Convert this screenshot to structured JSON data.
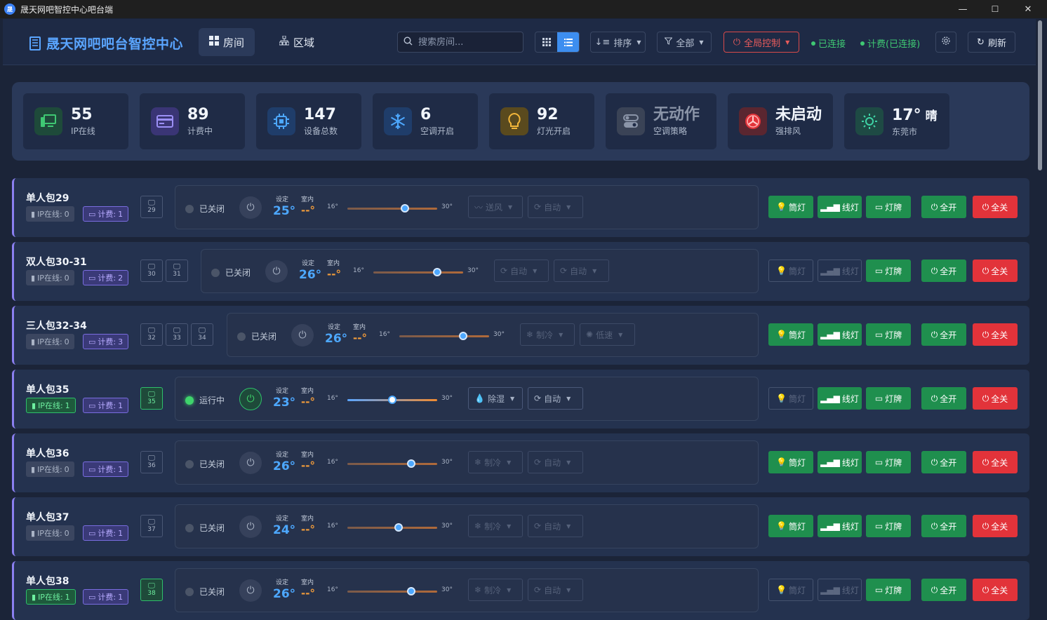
{
  "window": {
    "title": "晟天网吧智控中心吧台端",
    "app_icon": "晟",
    "min_label": "—",
    "max_label": "☐",
    "close_label": "✕"
  },
  "header": {
    "logo_text": "晟天网吧吧台智控中心",
    "nav": [
      {
        "label": "房间",
        "icon": "grid-icon"
      },
      {
        "label": "区域",
        "icon": "hierarchy-icon"
      }
    ],
    "search_placeholder": "搜索房间...",
    "sort_label": "排序",
    "filter_label": "全部",
    "global_control_label": "全局控制",
    "status_connected": "已连接",
    "status_billing": "计费(已连接)",
    "refresh_label": "刷新"
  },
  "stats": [
    {
      "value": "55",
      "label": "IP在线",
      "icon": "monitor-icon",
      "color": "#3fc873"
    },
    {
      "value": "89",
      "label": "计费中",
      "icon": "card-icon",
      "color": "#8b7ff0"
    },
    {
      "value": "147",
      "label": "设备总数",
      "icon": "chip-icon",
      "color": "#4da8ff"
    },
    {
      "value": "6",
      "label": "空调开启",
      "icon": "snowflake-icon",
      "color": "#4da8ff"
    },
    {
      "value": "92",
      "label": "灯光开启",
      "icon": "bulb-icon",
      "color": "#f4b73a"
    },
    {
      "value": "无动作",
      "label": "空调策略",
      "icon": "toggle-icon",
      "color": "#8b95a8"
    },
    {
      "value": "未启动",
      "label": "强排风",
      "icon": "fan-icon",
      "color": "#e2333a"
    },
    {
      "value": "17°",
      "value_suffix": "晴",
      "label": "东莞市",
      "icon": "sun-icon",
      "color": "#3fd4a6"
    }
  ],
  "labels": {
    "ip_online": "IP在线:",
    "billing": "计费:",
    "set": "设定",
    "indoor": "室内",
    "min": "16°",
    "max": "30°",
    "indoor_value": "--°",
    "btn_downlight": "筒灯",
    "btn_linelight": "线灯",
    "btn_sign": "灯牌",
    "btn_all_on": "全开",
    "btn_all_off": "全关"
  },
  "rooms": [
    {
      "name": "单人包29",
      "ip_online": "0",
      "billing": "1",
      "pcs": [
        "29"
      ],
      "pcs_on": [
        false
      ],
      "status": "已关闭",
      "on": false,
      "set_temp": "25°",
      "temp_value": 25,
      "mode": "送风",
      "fan": "自动",
      "downlight": true,
      "linelight": true
    },
    {
      "name": "双人包30-31",
      "ip_online": "0",
      "billing": "2",
      "pcs": [
        "30",
        "31"
      ],
      "pcs_on": [
        false,
        false
      ],
      "status": "已关闭",
      "on": false,
      "set_temp": "26°",
      "temp_value": 26,
      "mode": "自动",
      "fan": "自动",
      "downlight": false,
      "linelight": false
    },
    {
      "name": "三人包32-34",
      "ip_online": "0",
      "billing": "3",
      "pcs": [
        "32",
        "33",
        "34"
      ],
      "pcs_on": [
        false,
        false,
        false
      ],
      "status": "已关闭",
      "on": false,
      "set_temp": "26°",
      "temp_value": 26,
      "mode": "制冷",
      "fan": "低速",
      "downlight": true,
      "linelight": true
    },
    {
      "name": "单人包35",
      "ip_online": "1",
      "billing": "1",
      "pcs": [
        "35"
      ],
      "pcs_on": [
        true
      ],
      "status": "运行中",
      "on": true,
      "set_temp": "23°",
      "temp_value": 23,
      "mode": "除湿",
      "fan": "自动",
      "downlight": false,
      "linelight": true
    },
    {
      "name": "单人包36",
      "ip_online": "0",
      "billing": "1",
      "pcs": [
        "36"
      ],
      "pcs_on": [
        false
      ],
      "status": "已关闭",
      "on": false,
      "set_temp": "26°",
      "temp_value": 26,
      "mode": "制冷",
      "fan": "自动",
      "downlight": true,
      "linelight": true
    },
    {
      "name": "单人包37",
      "ip_online": "0",
      "billing": "1",
      "pcs": [
        "37"
      ],
      "pcs_on": [
        false
      ],
      "status": "已关闭",
      "on": false,
      "set_temp": "24°",
      "temp_value": 24,
      "mode": "制冷",
      "fan": "自动",
      "downlight": true,
      "linelight": true
    },
    {
      "name": "单人包38",
      "ip_online": "1",
      "billing": "1",
      "pcs": [
        "38"
      ],
      "pcs_on": [
        true
      ],
      "status": "已关闭",
      "on": false,
      "set_temp": "26°",
      "temp_value": 26,
      "mode": "制冷",
      "fan": "自动",
      "downlight": false,
      "linelight": false
    }
  ]
}
